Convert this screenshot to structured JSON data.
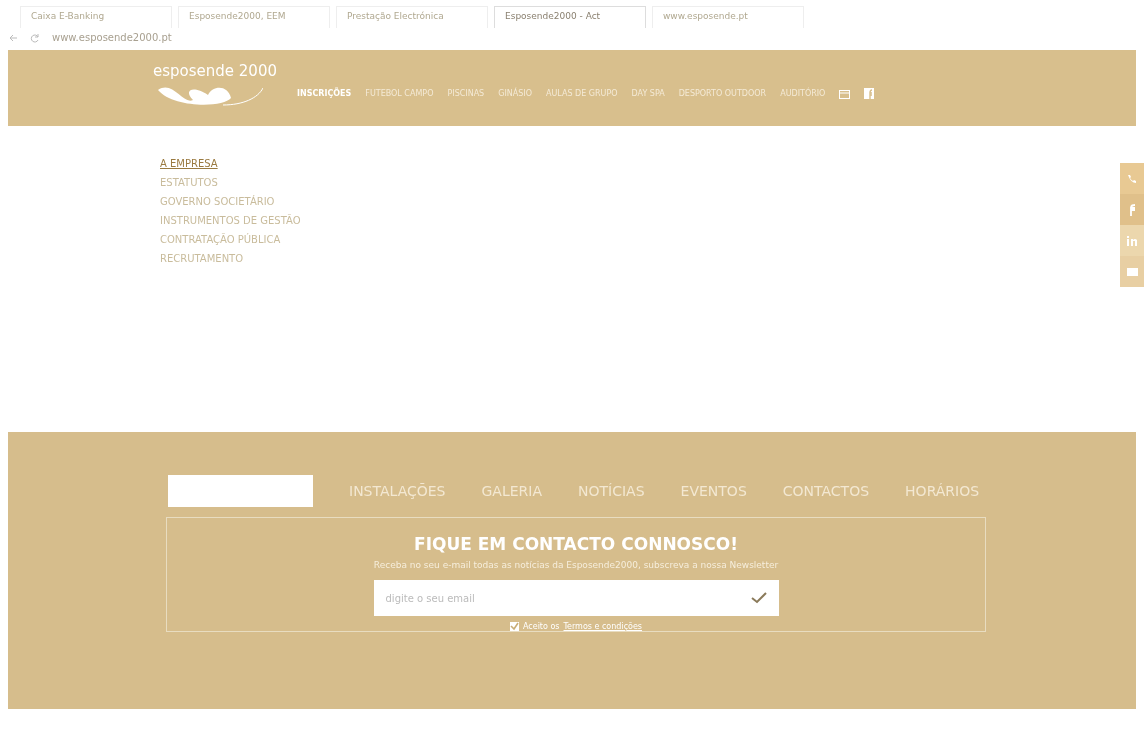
{
  "browser": {
    "tabs": [
      {
        "label": "Caixa E-Banking",
        "selected": false
      },
      {
        "label": "Esposende2000, EEM",
        "selected": false
      },
      {
        "label": "Prestação Electrónica",
        "selected": false
      },
      {
        "label": "Esposende2000 - Act",
        "selected": true
      },
      {
        "label": "www.esposende.pt",
        "selected": false
      }
    ],
    "address": "www.esposende2000.pt"
  },
  "header": {
    "logo": "esposende 2000",
    "nav": [
      {
        "label": "INSCRIÇÕES",
        "selected": true
      },
      {
        "label": "FUTEBOL CAMPO",
        "selected": false
      },
      {
        "label": "PISCINAS",
        "selected": false
      },
      {
        "label": "GINÁSIO",
        "selected": false
      },
      {
        "label": "AULAS DE GRUPO",
        "selected": false
      },
      {
        "label": "DAY SPA",
        "selected": false
      },
      {
        "label": "DESPORTO OUTDOOR",
        "selected": false
      },
      {
        "label": "AUDITÓRIO",
        "selected": false
      }
    ]
  },
  "sidebar": {
    "items": [
      {
        "label": "A EMPRESA",
        "selected": true
      },
      {
        "label": "ESTATUTOS",
        "selected": false
      },
      {
        "label": "GOVERNO SOCIETÁRIO",
        "selected": false
      },
      {
        "label": "INSTRUMENTOS DE GESTÃO",
        "selected": false
      },
      {
        "label": "CONTRATAÇÃO PÚBLICA",
        "selected": false
      },
      {
        "label": "RECRUTAMENTO",
        "selected": false
      }
    ]
  },
  "footer": {
    "nav": [
      "INSTALAÇÕES",
      "GALERIA",
      "NOTÍCIAS",
      "EVENTOS",
      "CONTACTOS",
      "HORÁRIOS"
    ],
    "newsletter": {
      "title": "FIQUE EM CONTACTO CONNOSCO!",
      "text": "Receba no seu e-mail todas as notícias da Esposende2000, subscreva a nossa Newsletter",
      "placeholder": "digite o seu email",
      "agree_checked": true,
      "agree_text": "Aceito os",
      "agree_link": "Termos e condições"
    }
  }
}
